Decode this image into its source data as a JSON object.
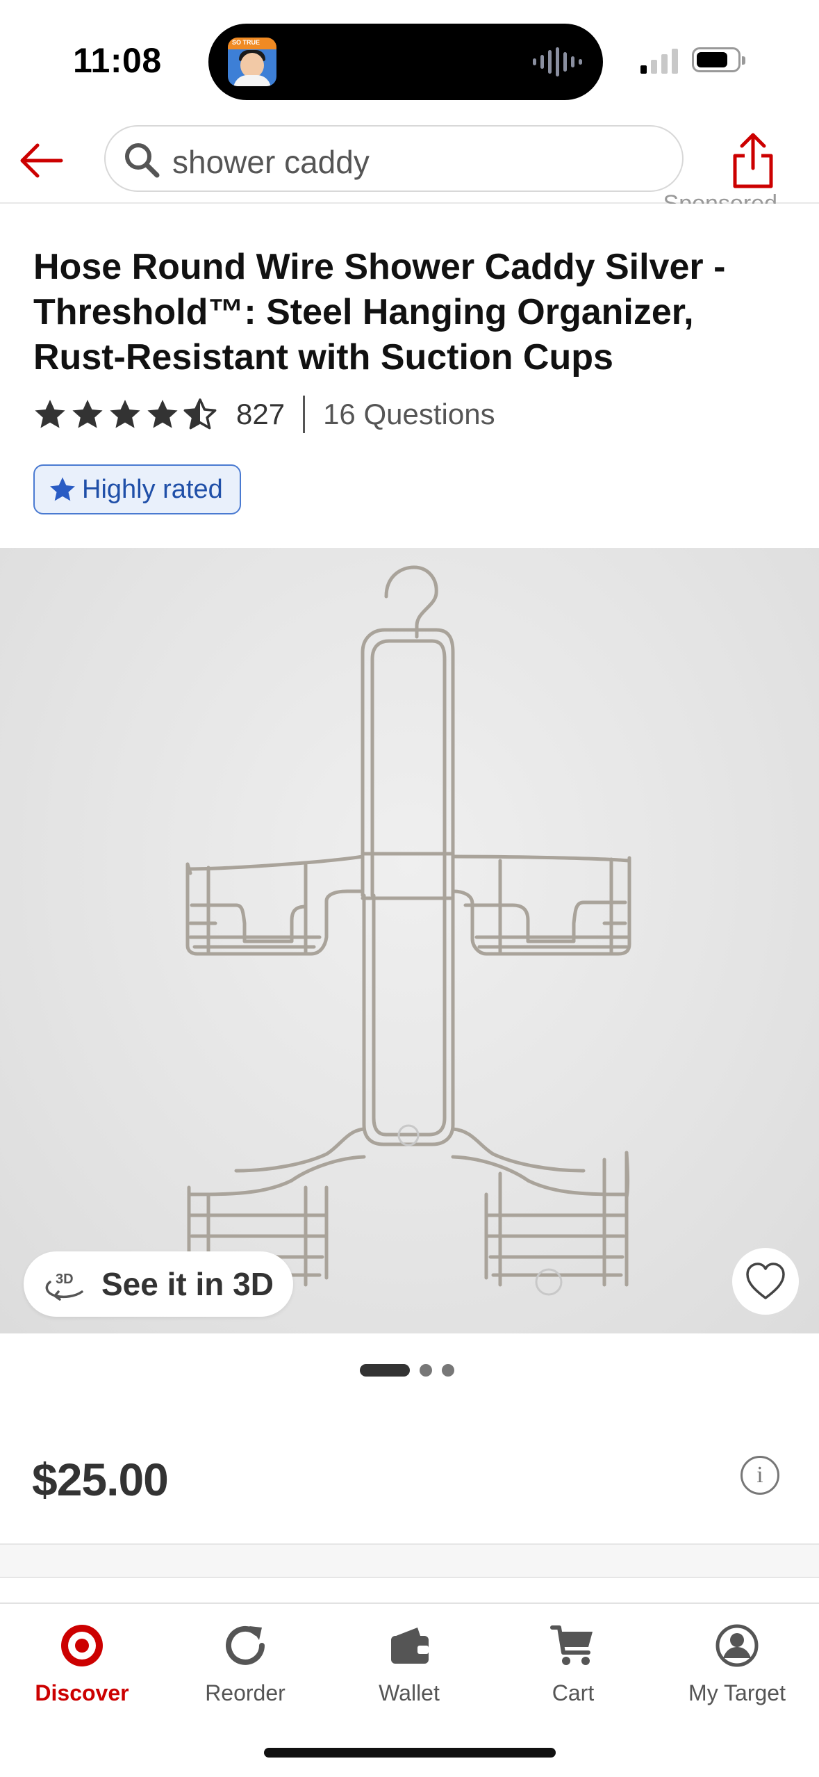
{
  "status_bar": {
    "time": "11:08",
    "island_badge": "SO TRUE"
  },
  "header": {
    "search_query": "shower caddy",
    "cutoff_text": "Sponsored"
  },
  "product": {
    "title": "Hose Round Wire Shower Caddy Silver - Threshold™: Steel Hanging Organizer, Rust-Resistant with Suction Cups",
    "rating": 4.5,
    "review_count": "827",
    "questions": "16 Questions",
    "badge": "Highly rated",
    "price": "$25.00",
    "info": "i"
  },
  "gallery": {
    "view_3d_label": "See it in 3D",
    "image_count": 3,
    "active_index": 0
  },
  "tabbar": {
    "items": [
      {
        "label": "Discover",
        "icon": "target-logo-icon",
        "active": true
      },
      {
        "label": "Reorder",
        "icon": "reorder-icon",
        "active": false
      },
      {
        "label": "Wallet",
        "icon": "wallet-icon",
        "active": false
      },
      {
        "label": "Cart",
        "icon": "cart-icon",
        "active": false
      },
      {
        "label": "My Target",
        "icon": "account-icon",
        "active": false
      }
    ]
  },
  "colors": {
    "brand_red": "#cc0000",
    "badge_blue": "#1f4fa8",
    "badge_bg": "#e9f0fb"
  }
}
